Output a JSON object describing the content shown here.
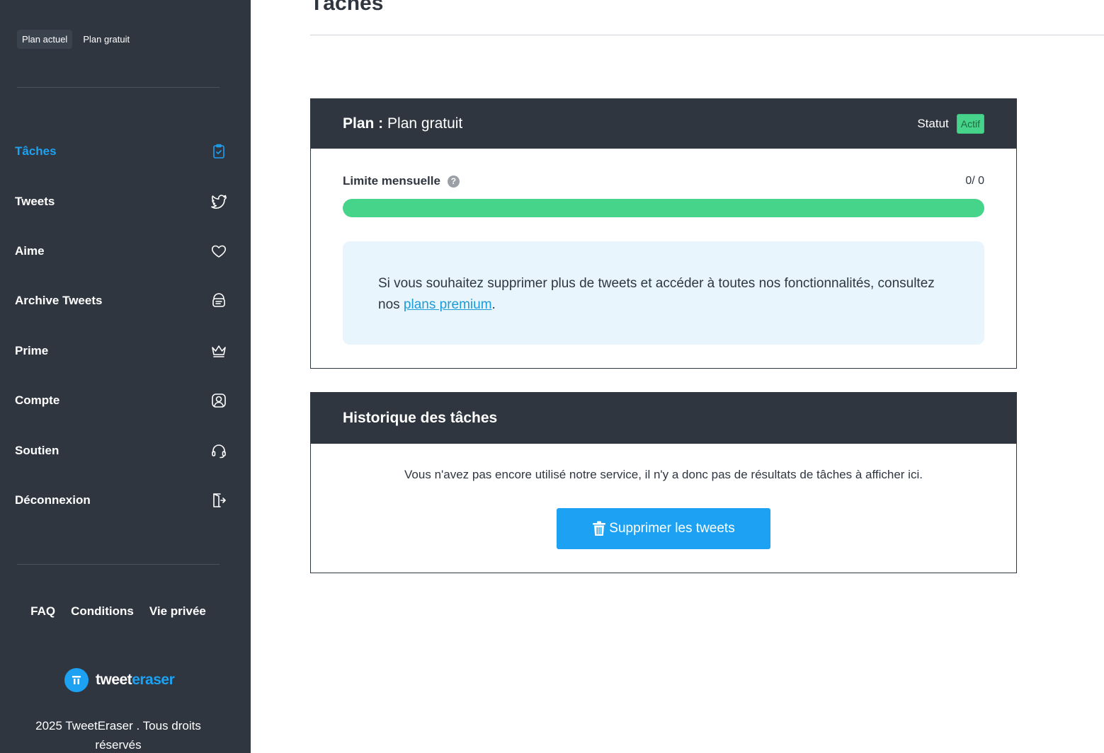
{
  "sidebar": {
    "plan_tags": {
      "current": "Plan actuel",
      "plan": "Plan gratuit"
    },
    "nav": [
      {
        "label": "Tâches",
        "icon": "clipboard-check-icon",
        "active": true
      },
      {
        "label": "Tweets",
        "icon": "twitter-bird-icon"
      },
      {
        "label": "Aime",
        "icon": "heart-icon"
      },
      {
        "label": "Archive Tweets",
        "icon": "archive-icon"
      },
      {
        "label": "Prime",
        "icon": "crown-icon"
      },
      {
        "label": "Compte",
        "icon": "user-icon"
      },
      {
        "label": "Soutien",
        "icon": "headset-icon"
      },
      {
        "label": "Déconnexion",
        "icon": "logout-icon"
      }
    ],
    "footer_links": {
      "faq": "FAQ",
      "conditions": "Conditions",
      "privacy": "Vie privée"
    },
    "logo": {
      "part1": "tweet",
      "part2": "eraser"
    },
    "copyright": "2025 TweetEraser . Tous droits réservés"
  },
  "main": {
    "title": "Tâches",
    "plan_card": {
      "plan_prefix": "Plan :",
      "plan_name": "Plan gratuit",
      "status_label": "Statut",
      "status_value": "Actif",
      "limit_label": "Limite mensuelle",
      "limit_count": "0/ 0",
      "progress_fraction": 1.0,
      "info_text": "Si vous souhaitez supprimer plus de tweets et accéder à toutes nos fonctionnalités, consultez nos",
      "info_link": "plans premium",
      "info_end": "."
    },
    "history_card": {
      "title": "Historique des tâches",
      "empty_message": "Vous n'avez pas encore utilisé notre service, il n'y a donc pas de résultats de tâches à afficher ici.",
      "button_label": "Supprimer les tweets"
    }
  },
  "colors": {
    "sidebar": "#2f3640",
    "accent": "#1da1f2",
    "success": "#46d38a",
    "info_bg": "#e8f5fd"
  }
}
